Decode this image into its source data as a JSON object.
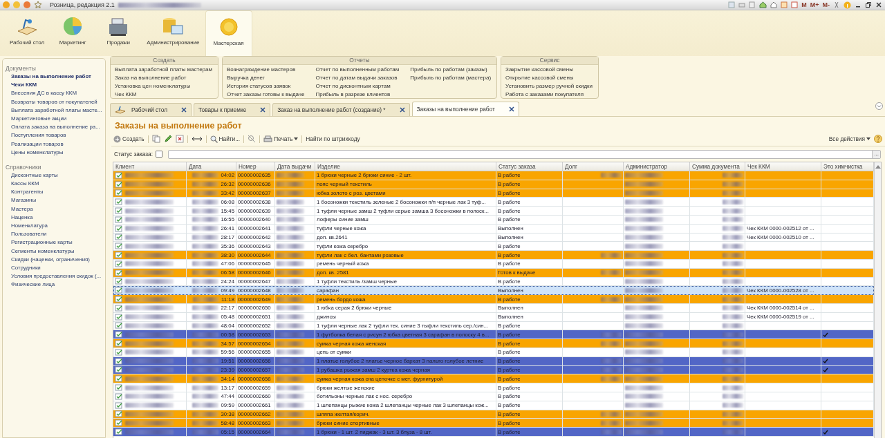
{
  "window": {
    "title": "Розница, редакция 2.1",
    "memory_buttons": [
      "M",
      "M+",
      "M-"
    ]
  },
  "sections": [
    {
      "label": "Рабочий стол",
      "selected": false
    },
    {
      "label": "Маркетинг",
      "selected": false
    },
    {
      "label": "Продажи",
      "selected": false
    },
    {
      "label": "Администрирование",
      "selected": false
    },
    {
      "label": "Мастерская",
      "selected": true
    }
  ],
  "sidebar": [
    {
      "title": "Документы",
      "items": [
        {
          "label": "Заказы на выполнение работ",
          "active": true
        },
        {
          "label": "Чеки ККМ",
          "active": true
        },
        {
          "label": "Внесения ДС в кассу ККМ",
          "active": false
        },
        {
          "label": "Возвраты товаров от покупателей",
          "active": false
        },
        {
          "label": "Выплата заработной платы масте...",
          "active": false
        },
        {
          "label": "Маркетинговые акции",
          "active": false
        },
        {
          "label": "Оплата заказа на выполнение ра...",
          "active": false
        },
        {
          "label": "Поступления товаров",
          "active": false
        },
        {
          "label": "Реализации товаров",
          "active": false
        },
        {
          "label": "Цены номенклатуры",
          "active": false
        }
      ]
    },
    {
      "title": "Справочники",
      "items": [
        {
          "label": "Дисконтные карты",
          "active": false
        },
        {
          "label": "Кассы ККМ",
          "active": false
        },
        {
          "label": "Контрагенты",
          "active": false
        },
        {
          "label": "Магазины",
          "active": false
        },
        {
          "label": "Мастера",
          "active": false
        },
        {
          "label": "Наценка",
          "active": false
        },
        {
          "label": "Номенклатура",
          "active": false
        },
        {
          "label": "Пользователи",
          "active": false
        },
        {
          "label": "Регистрационные карты",
          "active": false
        },
        {
          "label": "Сегменты номенклатуры",
          "active": false
        },
        {
          "label": "Скидки (наценки, ограничения)",
          "active": false
        },
        {
          "label": "Сотрудники",
          "active": false
        },
        {
          "label": "Условия предоставления скидок (...",
          "active": false
        },
        {
          "label": "Физические лица",
          "active": false
        }
      ]
    }
  ],
  "command_panel": [
    {
      "title": "Создать",
      "columns": [
        [
          "Выплата заработной платы мастерам",
          "Заказ на выполнение работ",
          "Установка цен номенклатуры",
          "Чек ККМ"
        ]
      ]
    },
    {
      "title": "Отчеты",
      "columns": [
        [
          "Вознаграждение мастеров",
          "Выручка денег",
          "История статусов заявок",
          "Отчет заказы готовы к выдаче"
        ],
        [
          "Отчет по выполненным работам",
          "Отчет по датам выдачи заказов",
          "Отчет по дисконтным картам",
          "Прибыль в разрезе клиентов"
        ],
        [
          "Прибыль по работам (заказы)",
          "Прибыль по работам (мастера)"
        ]
      ]
    },
    {
      "title": "Сервис",
      "columns": [
        [
          "Закрытие кассовой смены",
          "Открытие кассовой смены",
          "Установить размер ручной скидки",
          "Работа с заказами покупателя"
        ]
      ]
    }
  ],
  "tabs": [
    {
      "label": "Рабочий стол",
      "selected": false
    },
    {
      "label": "Товары к приемке",
      "selected": false
    },
    {
      "label": "Заказ на выполнение работ (создание) *",
      "selected": false
    },
    {
      "label": "Заказы на выполнение работ",
      "selected": true
    }
  ],
  "form": {
    "title": "Заказы на выполнение работ",
    "create": "Создать",
    "find": "Найти...",
    "print": "Печать",
    "barcode": "Найти по штрихкоду",
    "all_actions": "Все действия",
    "filter_label": "Статус заказа:",
    "filter_checked": false,
    "select_button": "..."
  },
  "table": {
    "columns": [
      "Клиент",
      "Дата",
      "Номер",
      "Дата выдачи",
      "Изделие",
      "Статус заказа",
      "Долг",
      "Администратор",
      "Сумма документа",
      "Чек ККМ",
      "Это химчистка"
    ],
    "rows": [
      {
        "time": "04:02",
        "number": "00000002635",
        "item": "1 брюки черные 2 брюки синие - 2 шт.",
        "status": "В работе",
        "check": "",
        "color": "#f9a500",
        "selected": false,
        "has_debt": true,
        "dry_cleaning": false
      },
      {
        "time": "26:32",
        "number": "00000002636",
        "item": "пояс черный текстиль",
        "status": "В работе",
        "check": "",
        "color": "#f9a500",
        "selected": false,
        "has_debt": false,
        "dry_cleaning": false
      },
      {
        "time": "33:42",
        "number": "00000002637",
        "item": "юбка золото с роз. цветами",
        "status": "В работе",
        "check": "",
        "color": "#f9a500",
        "selected": false,
        "has_debt": false,
        "dry_cleaning": false
      },
      {
        "time": "06:08",
        "number": "00000002638",
        "item": "1 босоножки текстиль зеленые 2 босоножки п/п черные лак 3 туф...",
        "status": "В работе",
        "check": "",
        "color": "#ffffff",
        "selected": false,
        "has_debt": false,
        "dry_cleaning": false
      },
      {
        "time": "15:45",
        "number": "00000002639",
        "item": "1 туфли черные замш 2 туфли серые замша 3 босоножки в полоск...",
        "status": "В работе",
        "check": "",
        "color": "#ffffff",
        "selected": false,
        "has_debt": false,
        "dry_cleaning": false
      },
      {
        "time": "16:55",
        "number": "00000002640",
        "item": "лоферы синие замш",
        "status": "В работе",
        "check": "",
        "color": "#ffffff",
        "selected": false,
        "has_debt": false,
        "dry_cleaning": false
      },
      {
        "time": "26:41",
        "number": "00000002641",
        "item": "туфли черные кожа",
        "status": "Выполнен",
        "check": "Чек ККМ 0000-002512 от ...",
        "color": "#ffffff",
        "selected": false,
        "has_debt": false,
        "dry_cleaning": false
      },
      {
        "time": "28:17",
        "number": "00000002642",
        "item": "доп. кв.2641",
        "status": "Выполнен",
        "check": "Чек ККМ 0000-002510 от ...",
        "color": "#ffffff",
        "selected": false,
        "has_debt": false,
        "dry_cleaning": false
      },
      {
        "time": "35:36",
        "number": "00000002643",
        "item": "туфли кожа  серебро",
        "status": "В работе",
        "check": "",
        "color": "#ffffff",
        "selected": false,
        "has_debt": false,
        "dry_cleaning": false
      },
      {
        "time": "38:30",
        "number": "00000002644",
        "item": "туфли лак с бел. бантами розовые",
        "status": "В работе",
        "check": "",
        "color": "#f9a500",
        "selected": false,
        "has_debt": true,
        "dry_cleaning": false
      },
      {
        "time": "47:06",
        "number": "00000002645",
        "item": "ремень черный кожа",
        "status": "В работе",
        "check": "",
        "color": "#ffffff",
        "selected": false,
        "has_debt": false,
        "dry_cleaning": false
      },
      {
        "time": "06:58",
        "number": "00000002646",
        "item": "доп. кв. 2581",
        "status": "Готов к выдаче",
        "check": "",
        "color": "#f9a500",
        "selected": false,
        "has_debt": true,
        "dry_cleaning": false
      },
      {
        "time": "24:24",
        "number": "00000002647",
        "item": "1 туфли текстиль /замш черные",
        "status": "В работе",
        "check": "",
        "color": "#ffffff",
        "selected": false,
        "has_debt": false,
        "dry_cleaning": false
      },
      {
        "time": "09:49",
        "number": "00000002648",
        "item": "сарафан",
        "status": "Выполнен",
        "check": "Чек ККМ 0000-002528 от ...",
        "color": "#cfe3f9",
        "selected": true,
        "has_debt": false,
        "dry_cleaning": false
      },
      {
        "time": "11:18",
        "number": "00000002649",
        "item": "ремень бордо кожа",
        "status": "В работе",
        "check": "",
        "color": "#f9a500",
        "selected": false,
        "has_debt": true,
        "dry_cleaning": false
      },
      {
        "time": "22:17",
        "number": "00000002650",
        "item": "1 юбка серая 2 брюки черные",
        "status": "Выполнен",
        "check": "Чек ККМ 0000-002514 от ...",
        "color": "#ffffff",
        "selected": false,
        "has_debt": false,
        "dry_cleaning": false
      },
      {
        "time": "05:48",
        "number": "00000002651",
        "item": "джинсы",
        "status": "Выполнен",
        "check": "Чек ККМ 0000-002519 от ...",
        "color": "#ffffff",
        "selected": false,
        "has_debt": false,
        "dry_cleaning": false
      },
      {
        "time": "48:04",
        "number": "00000002652",
        "item": "1 туфли черные лак 2 туфли тек. синие 3 тыфли текстиль сер./син...",
        "status": "В работе",
        "check": "",
        "color": "#ffffff",
        "selected": false,
        "has_debt": false,
        "dry_cleaning": false
      },
      {
        "time": "00:58",
        "number": "00000002653",
        "item": "1 футболка белая с рисун 2 юбка цветная 3 сарафан в полоску 4 в...",
        "status": "В работе",
        "check": "",
        "color": "#5266c6",
        "selected": false,
        "has_debt": true,
        "dry_cleaning": true
      },
      {
        "time": "34:57",
        "number": "00000002654",
        "item": "сумка черная кожа женская",
        "status": "В работе",
        "check": "",
        "color": "#f9a500",
        "selected": false,
        "has_debt": true,
        "dry_cleaning": false
      },
      {
        "time": "59:56",
        "number": "00000002655",
        "item": "цепь от сумки",
        "status": "В работе",
        "check": "",
        "color": "#ffffff",
        "selected": false,
        "has_debt": false,
        "dry_cleaning": false
      },
      {
        "time": "19:51",
        "number": "00000002656",
        "item": "1 платье голубое 2 платье черное бархат 3 пальто голубое летние",
        "status": "В работе",
        "check": "",
        "color": "#5266c6",
        "selected": false,
        "has_debt": true,
        "dry_cleaning": true
      },
      {
        "time": "23:39",
        "number": "00000002657",
        "item": "1 рубашка  рыжая замш 2 куртка кожа черная",
        "status": "В работе",
        "check": "",
        "color": "#5266c6",
        "selected": false,
        "has_debt": true,
        "dry_cleaning": true
      },
      {
        "time": "34:14",
        "number": "00000002658",
        "item": "сумка черная кожа сна цепочке с мет. фурнитурой",
        "status": "В работе",
        "check": "",
        "color": "#f9a500",
        "selected": false,
        "has_debt": true,
        "dry_cleaning": false
      },
      {
        "time": "13:17",
        "number": "00000002659",
        "item": "брюки желтые женские",
        "status": "В работе",
        "check": "",
        "color": "#ffffff",
        "selected": false,
        "has_debt": false,
        "dry_cleaning": false
      },
      {
        "time": "47:44",
        "number": "00000002660",
        "item": "ботильоны черные лак с нос. серебро",
        "status": "В работе",
        "check": "",
        "color": "#ffffff",
        "selected": false,
        "has_debt": false,
        "dry_cleaning": false
      },
      {
        "time": "09:59",
        "number": "00000002661",
        "item": "1 шлепанцы рыжие кожа 2 шлепанцы черные лак 3 шлепанцы кож...",
        "status": "В работе",
        "check": "",
        "color": "#ffffff",
        "selected": false,
        "has_debt": false,
        "dry_cleaning": false
      },
      {
        "time": "30:38",
        "number": "00000002662",
        "item": "шляпа желтая/корич.",
        "status": "В работе",
        "check": "",
        "color": "#f9a500",
        "selected": false,
        "has_debt": true,
        "dry_cleaning": false
      },
      {
        "time": "58:48",
        "number": "00000002663",
        "item": "брюки синие спортивные",
        "status": "В работе",
        "check": "",
        "color": "#f9a500",
        "selected": false,
        "has_debt": true,
        "dry_cleaning": false
      },
      {
        "time": "05:15",
        "number": "00000002664",
        "item": "1 брюки - 1 шт. 2 пиджак - 3 шт. 3 блуза - 8 шт.",
        "status": "В работе",
        "check": "",
        "color": "#5266c6",
        "selected": false,
        "has_debt": true,
        "dry_cleaning": true
      }
    ]
  }
}
